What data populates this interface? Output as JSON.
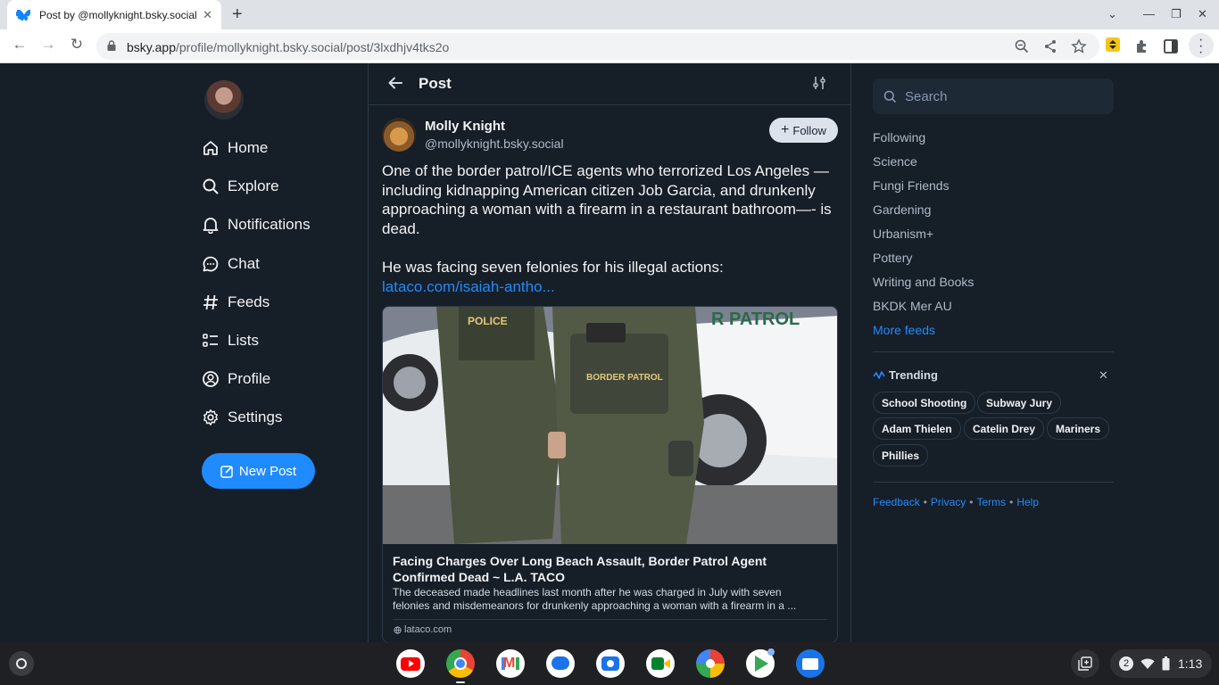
{
  "browser": {
    "tab_title": "Post by @mollyknight.bsky.social",
    "url_host": "bsky.app",
    "url_path": "/profile/mollyknight.bsky.social/post/3lxdhjv4tks2o"
  },
  "nav": {
    "items": [
      {
        "label": "Home",
        "icon": "home-icon"
      },
      {
        "label": "Explore",
        "icon": "search-icon"
      },
      {
        "label": "Notifications",
        "icon": "bell-icon"
      },
      {
        "label": "Chat",
        "icon": "chat-icon"
      },
      {
        "label": "Feeds",
        "icon": "hash-icon"
      },
      {
        "label": "Lists",
        "icon": "list-icon"
      },
      {
        "label": "Profile",
        "icon": "profile-icon"
      },
      {
        "label": "Settings",
        "icon": "gear-icon"
      }
    ],
    "new_post": "New Post"
  },
  "post": {
    "header_title": "Post",
    "author_name": "Molly Knight",
    "author_handle": "@mollyknight.bsky.social",
    "follow_label": "Follow",
    "text_p1": "One of the border patrol/ICE agents who terrorized Los Angeles — including kidnapping American citizen Job Garcia, and drunkenly approaching a woman with a firearm in a restaurant bathroom—- is dead.",
    "text_p2": "He was facing seven felonies for his illegal actions:",
    "link": "lataco.com/isaiah-antho...",
    "embed": {
      "title": "Facing Charges Over Long Beach Assault, Border Patrol Agent Confirmed Dead ~ L.A. TACO",
      "description": "The deceased made headlines last month after he was charged in July with seven felonies and misdemeanors for drunkenly approaching a woman with a firearm in a ...",
      "domain": "lataco.com",
      "image_text_left": "POLICE",
      "image_text_vest": "BORDER PATROL",
      "image_text_truck": "R PATROL"
    }
  },
  "sidebar": {
    "search_placeholder": "Search",
    "feeds": [
      "Following",
      "Science",
      "Fungi Friends",
      "Gardening",
      "Urbanism+",
      "Pottery",
      "Writing and Books",
      "BKDK Mer AU"
    ],
    "more_feeds": "More feeds",
    "trending_title": "Trending",
    "trending": [
      "School Shooting",
      "Subway Jury",
      "Adam Thielen",
      "Catelin Drey",
      "Mariners",
      "Phillies"
    ],
    "footer": [
      "Feedback",
      "Privacy",
      "Terms",
      "Help"
    ]
  },
  "shelf": {
    "notification_count": "2",
    "time": "1:13"
  },
  "colors": {
    "background": "#161e27",
    "accent": "#208bfe"
  }
}
